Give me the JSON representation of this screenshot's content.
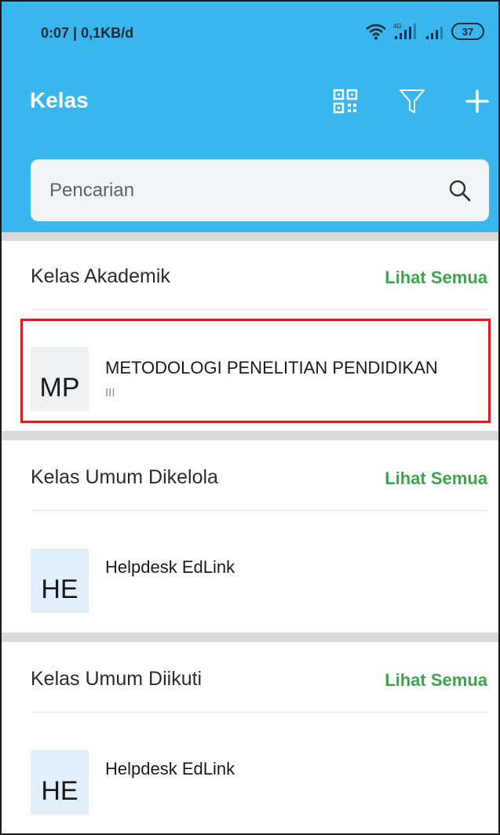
{
  "status_bar": {
    "time_speed": "0:07 | 0,1KB/d",
    "network_label": "4G",
    "battery": "37"
  },
  "app_bar": {
    "title": "Kelas",
    "icons": [
      "qr-code-icon",
      "filter-icon",
      "add-icon"
    ]
  },
  "search": {
    "placeholder": "Pencarian"
  },
  "sections": [
    {
      "title": "Kelas Akademik",
      "see_all": "Lihat Semua",
      "items": [
        {
          "initials": "MP",
          "name": "METODOLOGI PENELITIAN PENDIDIKAN",
          "subtitle": "III"
        }
      ]
    },
    {
      "title": "Kelas Umum Dikelola",
      "see_all": "Lihat Semua",
      "items": [
        {
          "initials": "HE",
          "name": "Helpdesk EdLink"
        }
      ]
    },
    {
      "title": "Kelas Umum Diikuti",
      "see_all": "Lihat Semua",
      "items": [
        {
          "initials": "HE",
          "name": "Helpdesk EdLink"
        }
      ]
    }
  ],
  "colors": {
    "header": "#3ab6ee",
    "accent_green": "#3aa44a",
    "highlight_red": "#d32027"
  }
}
